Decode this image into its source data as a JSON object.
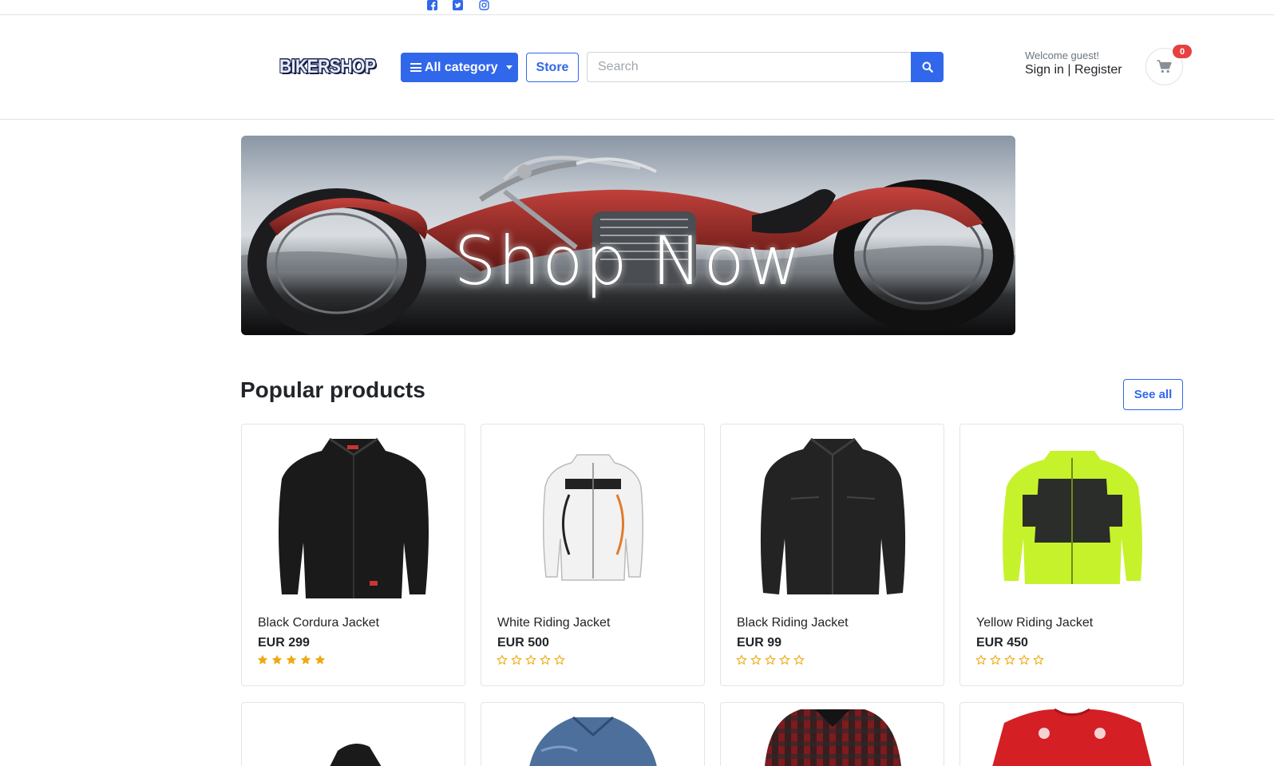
{
  "colors": {
    "primary": "#3167eb",
    "badge": "#e64040",
    "star": "#f0a912"
  },
  "topbar": {
    "icons": [
      "facebook-icon",
      "twitter-icon",
      "instagram-icon"
    ]
  },
  "header": {
    "logo": "BIKERSHOP",
    "category_label": "All category",
    "store_label": "Store",
    "search_placeholder": "Search",
    "welcome": "Welcome guest!",
    "sign_in": "Sign in",
    "separator": "|",
    "register": "Register",
    "cart_count": "0"
  },
  "banner": {
    "text": "Shop Now"
  },
  "section": {
    "title": "Popular products",
    "see_all": "See all"
  },
  "products": [
    {
      "name": "Black Cordura Jacket",
      "price": "EUR 299",
      "rating": 5,
      "image": "black-cordura-jacket"
    },
    {
      "name": "White Riding Jacket",
      "price": "EUR 500",
      "rating": 0,
      "image": "white-riding-jacket"
    },
    {
      "name": "Black Riding Jacket",
      "price": "EUR 99",
      "rating": 0,
      "image": "black-riding-jacket"
    },
    {
      "name": "Yellow Riding Jacket",
      "price": "EUR 450",
      "rating": 0,
      "image": "yellow-riding-jacket"
    }
  ],
  "next_row_images": [
    "black-jacket",
    "denim-jacket",
    "plaid-shirt",
    "red-tshirt"
  ]
}
